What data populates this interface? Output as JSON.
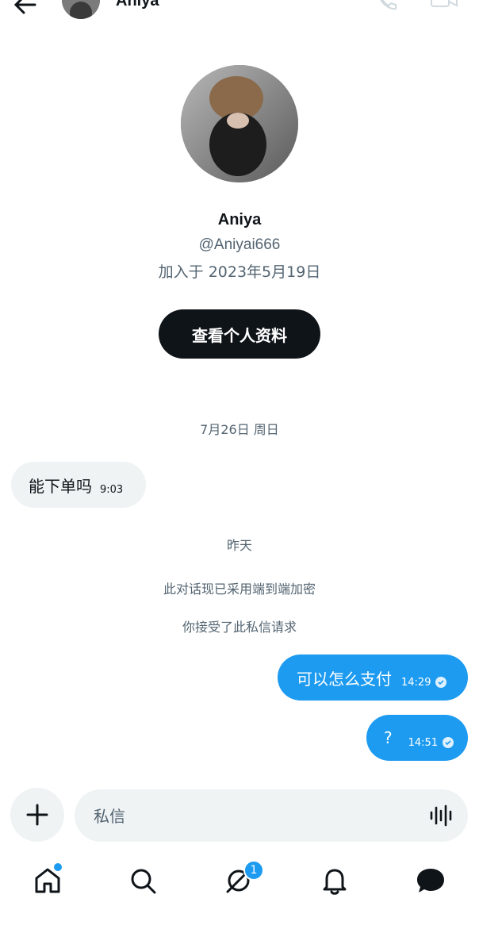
{
  "header": {
    "name": "Aniya"
  },
  "profile": {
    "name": "Aniya",
    "handle": "@Aniyai666",
    "joined": "加入于 2023年5月19日",
    "view_profile_label": "查看个人资料"
  },
  "conversation": {
    "date_separator_1": "7月26日 周日",
    "incoming_message": {
      "text": "能下单吗",
      "time": "9:03"
    },
    "date_separator_2": "昨天",
    "encryption_notice": "此对话现已采用端到端加密",
    "accepted_notice": "你接受了此私信请求",
    "outgoing_messages": [
      {
        "text": "可以怎么支付",
        "time": "14:29"
      },
      {
        "text": "?",
        "time": "14:51"
      }
    ]
  },
  "composer": {
    "placeholder": "私信"
  },
  "nav": {
    "messages_badge": "1"
  },
  "colors": {
    "accent": "#1d9bf0",
    "text": "#0f1419",
    "secondary_text": "#536471",
    "bubble_incoming": "#eff3f4"
  }
}
